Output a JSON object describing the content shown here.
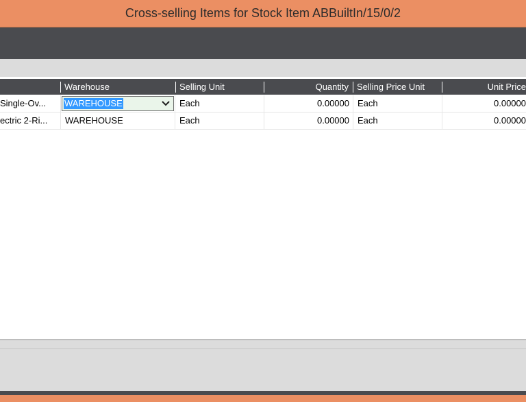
{
  "window": {
    "title": "Cross-selling Items for Stock Item ABBuiltIn/15/0/2",
    "accent_color": "#eb8f63",
    "toolbar_color": "#4a4b4f"
  },
  "grid": {
    "columns": [
      {
        "key": "item",
        "label": ""
      },
      {
        "key": "warehouse",
        "label": "Warehouse"
      },
      {
        "key": "selling_unit",
        "label": "Selling Unit"
      },
      {
        "key": "quantity",
        "label": "Quantity"
      },
      {
        "key": "selling_price_unit",
        "label": "Selling Price Unit"
      },
      {
        "key": "unit_price",
        "label": "Unit Price"
      }
    ],
    "rows": [
      {
        "item": "Single-Ov...",
        "warehouse": "WAREHOUSE",
        "selling_unit": "Each",
        "quantity": "0.00000",
        "selling_price_unit": "Each",
        "unit_price": "0.00000",
        "editing": true
      },
      {
        "item": "ectric 2-Ri...",
        "warehouse": "WAREHOUSE",
        "selling_unit": "Each",
        "quantity": "0.00000",
        "selling_price_unit": "Each",
        "unit_price": "0.00000",
        "editing": false
      }
    ],
    "editor_icon": "chevron-down-icon"
  }
}
